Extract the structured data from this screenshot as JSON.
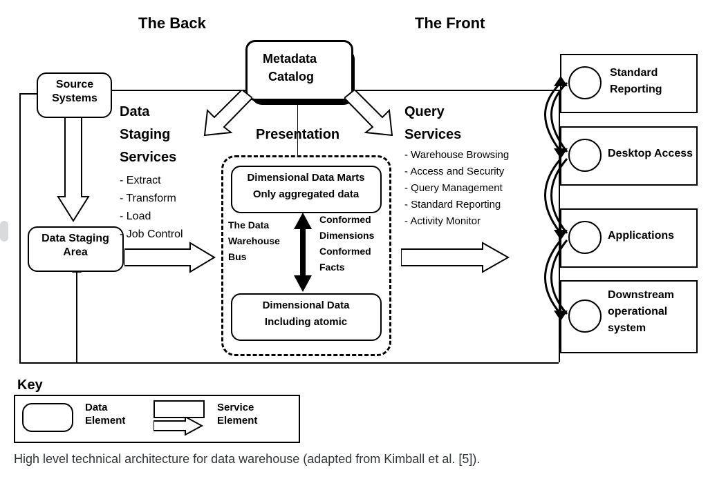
{
  "headings": {
    "back": "The Back",
    "front": "The Front",
    "presentation": "Presentation"
  },
  "nodes": {
    "source_systems": "Source Systems",
    "data_staging_area": "Data Staging Area",
    "metadata_catalog_l1": "Metadata",
    "metadata_catalog_l2": "Catalog",
    "dim_marts_l1": "Dimensional Data Marts",
    "dim_marts_l2": "Only aggregated data",
    "dim_atomic_l1": "Dimensional Data",
    "dim_atomic_l2": "Including atomic",
    "dw_bus_l1": "The Data",
    "dw_bus_l2": "Warehouse",
    "dw_bus_l3": "Bus",
    "conformed_l1": "Conformed",
    "conformed_l2": "Dimensions",
    "conformed_l3": "Conformed",
    "conformed_l4": "Facts",
    "standard_reporting_l1": "Standard",
    "standard_reporting_l2": "Reporting",
    "desktop_access": "Desktop Access",
    "applications": "Applications",
    "downstream_l1": "Downstream",
    "downstream_l2": "operational",
    "downstream_l3": "system"
  },
  "sections": {
    "data_staging": {
      "title_l1": "Data",
      "title_l2": "Staging",
      "title_l3": "Services",
      "items": [
        "- Extract",
        "- Transform",
        "- Load",
        "- Job Control"
      ]
    },
    "query_services": {
      "title_l1": "Query",
      "title_l2": "Services",
      "items": [
        "- Warehouse Browsing",
        "- Access and Security",
        "- Query Management",
        "- Standard Reporting",
        "- Activity Monitor"
      ]
    }
  },
  "key": {
    "title": "Key",
    "data_element": "Data Element",
    "service_element": "Service Element"
  },
  "caption": "High level technical architecture for data warehouse (adapted from Kimball et al. [5])."
}
